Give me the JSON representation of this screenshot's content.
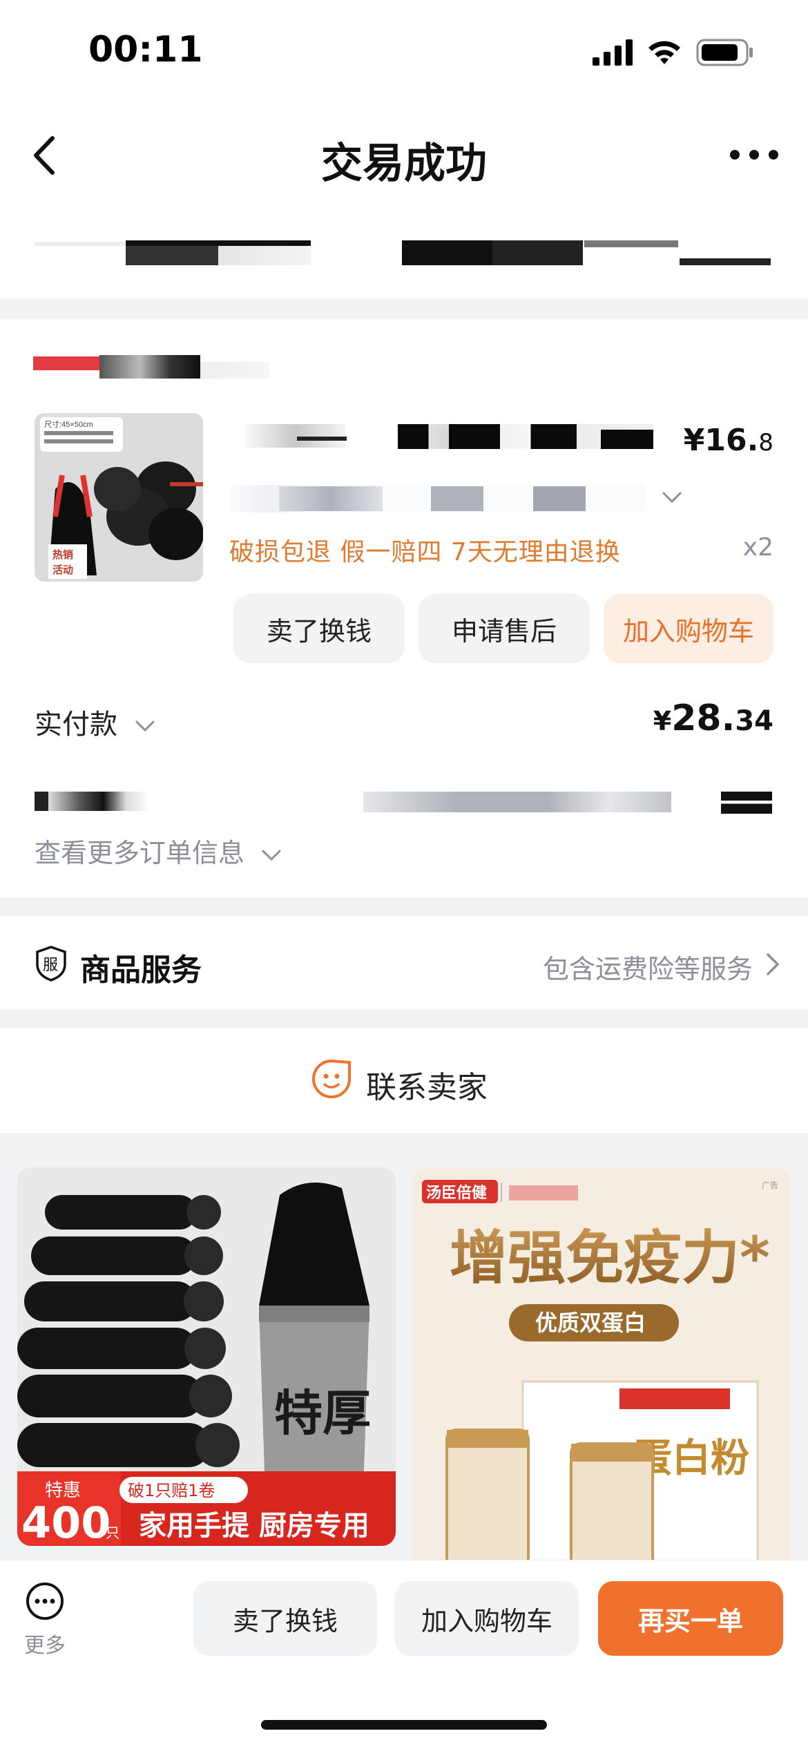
{
  "status_bar": {
    "time": "00:11"
  },
  "nav": {
    "title": "交易成功"
  },
  "order": {
    "price_main": "¥16.",
    "price_decimal": "8",
    "promises": "破损包退  假一赔四  7天无理由退换",
    "quantity": "x2",
    "thumb_top_text": "尺寸:45×50cm",
    "thumb_label": "热销活动",
    "buttons": {
      "sell": "卖了换钱",
      "after_sale": "申请售后",
      "add_cart": "加入购物车"
    },
    "paid_label": "实付款",
    "paid_currency": "¥",
    "paid_main": "28.",
    "paid_decimal": "34",
    "more_info": "查看更多订单信息"
  },
  "service": {
    "icon_char": "服",
    "title": "商品服务",
    "detail": "包含运费险等服务"
  },
  "contact": {
    "label": "联系卖家"
  },
  "recommendations": [
    {
      "big_text": "特厚",
      "badge_top": "特惠",
      "badge_num": "400",
      "badge_unit": "只",
      "pill": "破1只赔1卷",
      "banner": "家用手提 厨房专用"
    },
    {
      "brand": "汤臣倍健",
      "ad": "广告",
      "headline": "增强免疫力*",
      "sub": "优质双蛋白",
      "product_text": "蛋白粉"
    }
  ],
  "bottom_bar": {
    "more_label": "更多",
    "sell": "卖了换钱",
    "add_cart": "加入购物车",
    "buy_again": "再买一单"
  },
  "colors": {
    "accent": "#f0712c",
    "promise": "#e07a2f",
    "muted": "#8a8f99"
  }
}
